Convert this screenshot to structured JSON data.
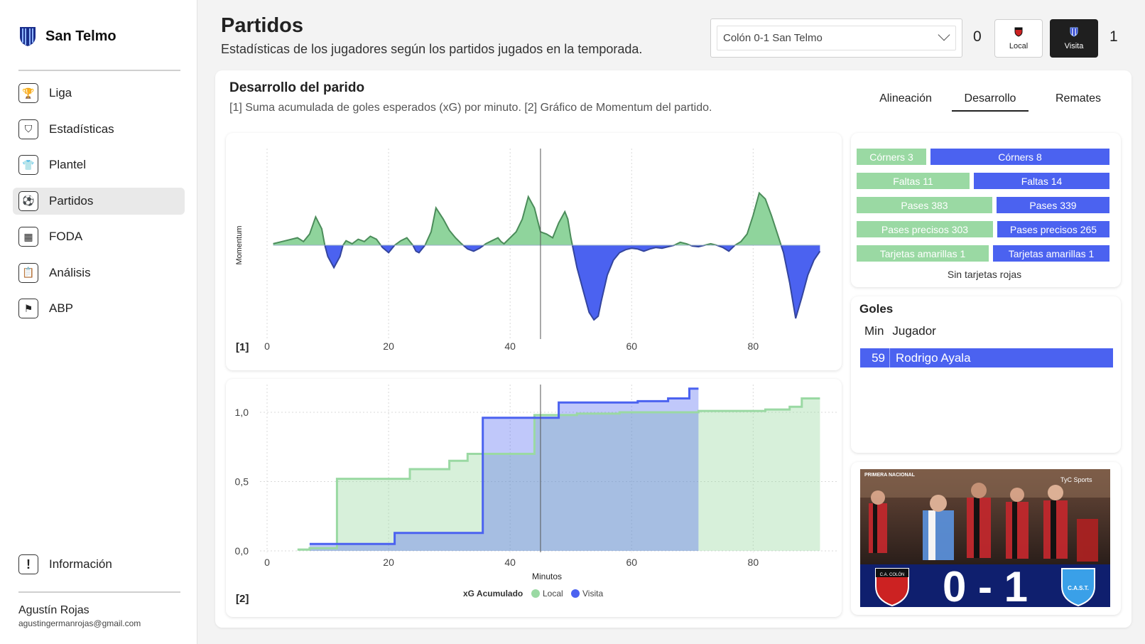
{
  "app": {
    "team_name": "San Telmo"
  },
  "sidebar": {
    "items": [
      {
        "label": "Liga",
        "icon": "trophy-icon",
        "active": false
      },
      {
        "label": "Estadísticas",
        "icon": "shield-chart-icon",
        "active": false
      },
      {
        "label": "Plantel",
        "icon": "shirt-icon",
        "active": false
      },
      {
        "label": "Partidos",
        "icon": "soccer-ball-icon",
        "active": true
      },
      {
        "label": "FODA",
        "icon": "grid-icon",
        "active": false
      },
      {
        "label": "Análisis",
        "icon": "clipboard-icon",
        "active": false
      },
      {
        "label": "ABP",
        "icon": "corner-flag-icon",
        "active": false
      }
    ],
    "info_label": "Información",
    "user": {
      "name": "Agustín Rojas",
      "email": "agustingermanrojas@gmail.com"
    }
  },
  "header": {
    "title": "Partidos",
    "subtitle": "Estadísticas de los jugadores según los partidos jugados en la temporada.",
    "match_select": "Colón 0-1 San Telmo",
    "score_local": "0",
    "score_visita": "1",
    "local_label": "Local",
    "visita_label": "Visita"
  },
  "section": {
    "title": "Desarrollo del parido",
    "subtitle": "[1] Suma acumulada de goles esperados (xG) por minuto. [2] Gráfico de Momentum del partido.",
    "tabs": [
      {
        "label": "Alineación",
        "active": false
      },
      {
        "label": "Desarrollo",
        "active": true
      },
      {
        "label": "Remates",
        "active": false
      }
    ]
  },
  "colors": {
    "local": "#9ad9a3",
    "visita": "#4b62f0",
    "momentum_green": "#8fd49c",
    "momentum_blue": "#4b62f0"
  },
  "stats": [
    {
      "local": "Córners 3",
      "visita": "Córners 8",
      "local_value": 3,
      "visita_value": 8
    },
    {
      "local": "Faltas 11",
      "visita": "Faltas 14",
      "local_value": 11,
      "visita_value": 14
    },
    {
      "local": "Pases 383",
      "visita": "Pases 339",
      "local_value": 383,
      "visita_value": 339
    },
    {
      "local": "Pases precisos 303",
      "visita": "Pases precisos 265",
      "local_value": 303,
      "visita_value": 265
    },
    {
      "local": "Tarjetas amarillas 1",
      "visita": "Tarjetas amarillas 1",
      "local_value": 1,
      "visita_value": 1
    }
  ],
  "no_red_cards": "Sin tarjetas rojas",
  "goals": {
    "title": "Goles",
    "col_min": "Min",
    "col_player": "Jugador",
    "rows": [
      {
        "min": "59",
        "player": "Rodrigo Ayala"
      }
    ]
  },
  "photo": {
    "league_badge": "PRIMERA NACIONAL",
    "broadcaster": "TyC Sports",
    "score_text": "0 - 1",
    "local_crest": "C.A. COLÓN",
    "visita_crest": "C.A.S.T."
  },
  "chart_data": [
    {
      "type": "area",
      "id": "momentum",
      "label": "[1]",
      "ylabel": "Momentum",
      "xlim": [
        0,
        92
      ],
      "x_ticks": [
        0,
        20,
        40,
        60,
        80
      ],
      "halftime_line": 45,
      "points": [
        [
          1,
          0.02
        ],
        [
          3,
          0.06
        ],
        [
          5,
          0.1
        ],
        [
          6,
          0.05
        ],
        [
          7,
          0.15
        ],
        [
          8,
          0.38
        ],
        [
          9,
          0.22
        ],
        [
          9.5,
          0
        ],
        [
          10,
          -0.15
        ],
        [
          11,
          -0.3
        ],
        [
          12,
          -0.15
        ],
        [
          12.5,
          0
        ],
        [
          13,
          0.06
        ],
        [
          14,
          0.02
        ],
        [
          15,
          0.08
        ],
        [
          16,
          0.05
        ],
        [
          17,
          0.12
        ],
        [
          18,
          0.08
        ],
        [
          19,
          -0.03
        ],
        [
          20,
          -0.1
        ],
        [
          21,
          0
        ],
        [
          22,
          0.06
        ],
        [
          23,
          0.1
        ],
        [
          24,
          0.0
        ],
        [
          24.5,
          -0.08
        ],
        [
          25,
          -0.1
        ],
        [
          26,
          0
        ],
        [
          27,
          0.18
        ],
        [
          27.8,
          0.5
        ],
        [
          29,
          0.35
        ],
        [
          30,
          0.2
        ],
        [
          31,
          0.1
        ],
        [
          32,
          0.02
        ],
        [
          33,
          -0.05
        ],
        [
          34,
          -0.08
        ],
        [
          35,
          -0.04
        ],
        [
          36,
          0.02
        ],
        [
          37,
          0.06
        ],
        [
          38,
          0.1
        ],
        [
          38.5,
          0.05
        ],
        [
          39,
          0.02
        ],
        [
          40,
          0.1
        ],
        [
          41,
          0.18
        ],
        [
          42,
          0.35
        ],
        [
          43,
          0.65
        ],
        [
          44,
          0.5
        ],
        [
          45,
          0.18
        ],
        [
          46,
          0.15
        ],
        [
          47,
          0.1
        ],
        [
          48,
          0.3
        ],
        [
          49,
          0.45
        ],
        [
          49.5,
          0.35
        ],
        [
          50,
          0.1
        ],
        [
          51,
          -0.3
        ],
        [
          52,
          -0.6
        ],
        [
          53,
          -0.9
        ],
        [
          53.8,
          -1.0
        ],
        [
          54.5,
          -0.95
        ],
        [
          55,
          -0.75
        ],
        [
          56,
          -0.4
        ],
        [
          57,
          -0.2
        ],
        [
          58,
          -0.1
        ],
        [
          59,
          -0.06
        ],
        [
          60,
          -0.04
        ],
        [
          61,
          -0.05
        ],
        [
          62,
          -0.08
        ],
        [
          63,
          -0.05
        ],
        [
          64,
          -0.03
        ],
        [
          65,
          -0.04
        ],
        [
          66,
          -0.02
        ],
        [
          67,
          0
        ],
        [
          68,
          0.04
        ],
        [
          69,
          0.02
        ],
        [
          70,
          -0.01
        ],
        [
          71,
          -0.02
        ],
        [
          72,
          0.0
        ],
        [
          73,
          0.02
        ],
        [
          74,
          0.0
        ],
        [
          75,
          -0.03
        ],
        [
          76,
          -0.08
        ],
        [
          77,
          0.0
        ],
        [
          78,
          0.05
        ],
        [
          79,
          0.15
        ],
        [
          80,
          0.4
        ],
        [
          81,
          0.7
        ],
        [
          82,
          0.62
        ],
        [
          83,
          0.4
        ],
        [
          84,
          0.15
        ],
        [
          85,
          -0.1
        ],
        [
          86,
          -0.5
        ],
        [
          87,
          -0.98
        ],
        [
          88,
          -0.7
        ],
        [
          89,
          -0.4
        ],
        [
          90,
          -0.2
        ],
        [
          91,
          -0.08
        ]
      ]
    },
    {
      "type": "line",
      "id": "xg",
      "label": "[2]",
      "xlabel": "Minutos",
      "legend_title": "xG Acumulado",
      "xlim": [
        0,
        92
      ],
      "ylim": [
        0,
        1.2
      ],
      "x_ticks": [
        0,
        20,
        40,
        60,
        80
      ],
      "y_ticks": [
        {
          "value": 0.0,
          "label": "0,0"
        },
        {
          "value": 0.5,
          "label": "0,5"
        },
        {
          "value": 1.0,
          "label": "1,0"
        }
      ],
      "halftime_line": 45,
      "series": [
        {
          "name": "Local",
          "color": "#9ad9a3",
          "steps": [
            [
              5,
              0.01
            ],
            [
              7,
              0.02
            ],
            [
              11.5,
              0.52
            ],
            [
              23.5,
              0.59
            ],
            [
              30,
              0.65
            ],
            [
              33,
              0.7
            ],
            [
              44,
              0.98
            ],
            [
              51,
              0.99
            ],
            [
              58,
              1.0
            ],
            [
              69,
              1.0
            ],
            [
              71,
              1.01
            ],
            [
              82,
              1.02
            ],
            [
              86,
              1.04
            ],
            [
              88,
              1.1
            ],
            [
              91,
              1.1
            ]
          ]
        },
        {
          "name": "Visita",
          "color": "#4b62f0",
          "steps": [
            [
              7,
              0.05
            ],
            [
              21,
              0.13
            ],
            [
              35.5,
              0.96
            ],
            [
              48,
              1.07
            ],
            [
              61,
              1.08
            ],
            [
              66,
              1.1
            ],
            [
              69.5,
              1.17
            ],
            [
              71,
              1.17
            ]
          ]
        }
      ]
    }
  ]
}
